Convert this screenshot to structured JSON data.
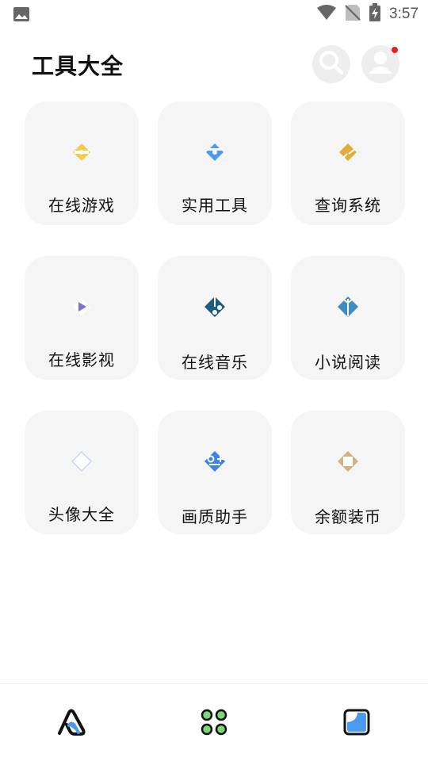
{
  "status_bar": {
    "time": "3:57",
    "icons": [
      "image-icon",
      "wifi-icon",
      "no-sim-icon",
      "battery-charging-icon"
    ]
  },
  "header": {
    "title": "工具大全",
    "search_icon": "search-icon",
    "profile_icon": "user-icon",
    "has_notification": true
  },
  "categories": [
    {
      "label": "在线游戏",
      "icon": "game-icon",
      "color": "#F7C948"
    },
    {
      "label": "实用工具",
      "icon": "tool-icon",
      "color": "#4A9BF0"
    },
    {
      "label": "查询系统",
      "icon": "query-icon",
      "color": "#E6A93C"
    },
    {
      "label": "在线影视",
      "icon": "video-icon",
      "color": "#7A72D8"
    },
    {
      "label": "在线音乐",
      "icon": "music-icon",
      "color": "#1E5E7A"
    },
    {
      "label": "小说阅读",
      "icon": "book-icon",
      "color": "#3E8CC2"
    },
    {
      "label": "头像大全",
      "icon": "avatar-icon",
      "color": "#BFD8F5"
    },
    {
      "label": "画质助手",
      "icon": "quality-icon",
      "color": "#3B83E6"
    },
    {
      "label": "余额装币",
      "icon": "coin-icon",
      "color": "#D3B182"
    }
  ],
  "bottom_nav": [
    {
      "icon": "home-logo-icon",
      "active": true
    },
    {
      "icon": "apps-grid-icon",
      "active": false
    },
    {
      "icon": "gallery-icon",
      "active": false
    }
  ],
  "colors": {
    "card_bg": "#F5F5F5",
    "notification": "#EE1B1B",
    "apps_green": "#7CD67A",
    "gallery_blue": "#4A9BF0"
  }
}
